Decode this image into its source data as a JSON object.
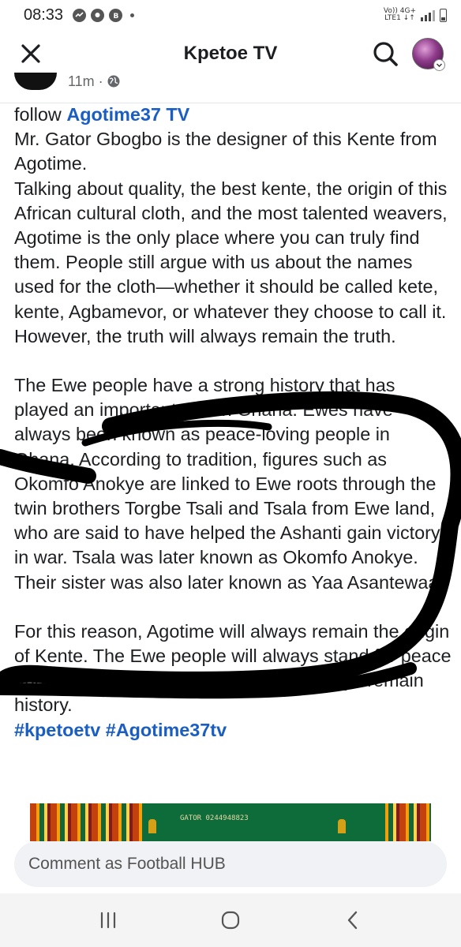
{
  "status_bar": {
    "time": "08:33",
    "network_top": "Vo)) 4G+",
    "network_bottom": "LTE1 ↓↑"
  },
  "header": {
    "title": "Kpetoe TV",
    "close_icon": "close-icon",
    "search_icon": "search-icon"
  },
  "post": {
    "time_ago": "11m ·",
    "follow_prefix": "follow ",
    "follow_link": "Agotime37 TV",
    "paragraph1": "Mr. Gator Gbogbo is the designer of this Kente from Agotime.\nTalking about quality, the best kente, the origin of this African cultural cloth, and the most talented weavers, Agotime is the only place where you can truly find them. People still argue with us about the names used for the cloth—whether it should be called kete, kente, Agbamevor, or whatever they choose to call it. However, the truth will always remain the truth.",
    "paragraph2": "The Ewe people have a strong history that has played an important role in Ghana. Ewes have always been known as peace-loving people in Ghana. According to tradition, figures such as Okomfo Anokye are linked to Ewe roots through the twin brothers Torgbe Tsali and Tsala from Ewe land, who are said to have helped the Ashanti gain victory in war. Tsala was later known as Okomfo Anokye. Their sister was also later known as Yaa Asantewaa.",
    "paragraph3": "For this reason, Agotime will always remain the origin of Kente. The Ewe people will always stand for peace and unity in Ghana, and history will always remain history.",
    "hashtags": "#kpetoetv #Agotime37tv",
    "image_text": "GATOR 0244948823"
  },
  "comment": {
    "placeholder": "Comment as Football HUB"
  },
  "colors": {
    "link": "#1a5ec4",
    "text": "#1c1e21",
    "scribble": "#000000"
  }
}
